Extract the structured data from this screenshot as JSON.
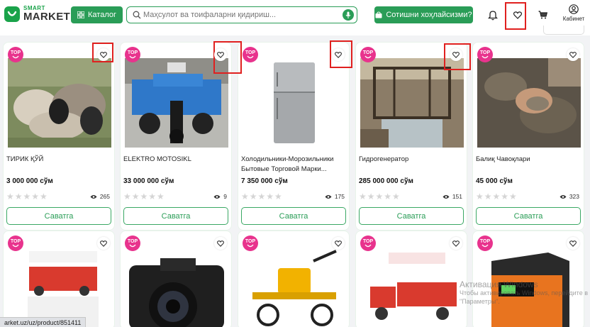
{
  "header": {
    "logo_small": "SMART",
    "logo_big": "MARKET",
    "catalog_label": "Каталог",
    "search_placeholder": "Маҳсулот ва тоифаларни қидириш...",
    "sell_label": "Сотишни хоҳлайсизми?",
    "cabinet_label": "Кабинет"
  },
  "badge": {
    "line1": "TOP"
  },
  "products": [
    {
      "title": "ТИРИК ҚЎЙ",
      "price": "3 000 000 сўм",
      "stars": "★★★★★",
      "views": "265",
      "cart_label": "Саватга"
    },
    {
      "title": "ELEKTRO MOTOSIKL",
      "price": "33 000 000 сўм",
      "stars": "★★★★★",
      "views": "9",
      "cart_label": "Саватга"
    },
    {
      "title": "Холодильники-Морозильники Бытовые Торговой Марки...",
      "price": "7 350 000 сўм",
      "stars": "★★★★★",
      "views": "175",
      "cart_label": "Саватга"
    },
    {
      "title": "Гидрогенератор",
      "price": "285 000 000 сўм",
      "stars": "★★★★★",
      "views": "151",
      "cart_label": "Саватга"
    },
    {
      "title": "Балиқ Чавоқлари",
      "price": "45 000 сўм",
      "stars": "★★★★★",
      "views": "323",
      "cart_label": "Саватга"
    }
  ],
  "statusbar": {
    "url": "arket.uz/uz/product/851411"
  },
  "watermark": {
    "line1": "Активация Windows",
    "line2": "Чтобы активировать Windows, перейдите в",
    "line3": "\"Параметры\"."
  },
  "colors": {
    "brand": "#2a9d57",
    "badge": "#e8338d",
    "highlight": "#e0201f"
  }
}
